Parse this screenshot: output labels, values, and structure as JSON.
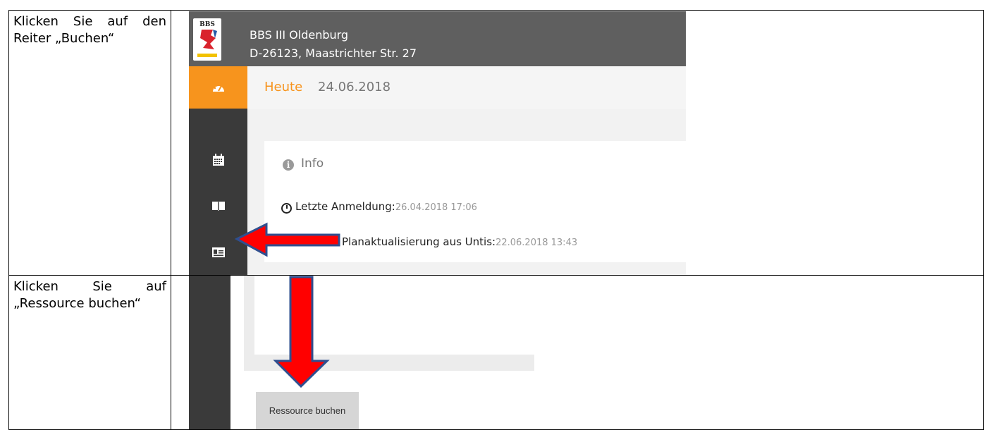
{
  "rows": [
    {
      "instruction": "Klicken Sie auf den Reiter „Bu­chen“",
      "screenshot": {
        "school_name": "BBS III Oldenburg",
        "school_address": "D-26123, Maastrichter Str. 27",
        "logo_text": "BBS",
        "sidebar_icons": [
          "dashboard-icon",
          "calendar-icon",
          "book-icon",
          "id-card-icon"
        ],
        "today_label": "Heute",
        "today_date": "24.06.2018",
        "info_title": "Info",
        "last_login_label": "Letzte Anmeldung:",
        "last_login_value": "26.04.2018 17:06",
        "plan_update_label": "Planaktualisierung aus Untis:",
        "plan_update_value": "22.06.2018 13:43"
      }
    },
    {
      "instruction": "Klicken Sie auf „Ressource bu­chen“",
      "screenshot": {
        "button_label": "Ressource buchen"
      }
    }
  ],
  "colors": {
    "accent_orange": "#f7941d",
    "topbar_gray": "#5f5f5f",
    "sidebar_dark": "#3a3a3a",
    "arrow_red": "#ff0000",
    "arrow_outline": "#2f4f8f"
  }
}
